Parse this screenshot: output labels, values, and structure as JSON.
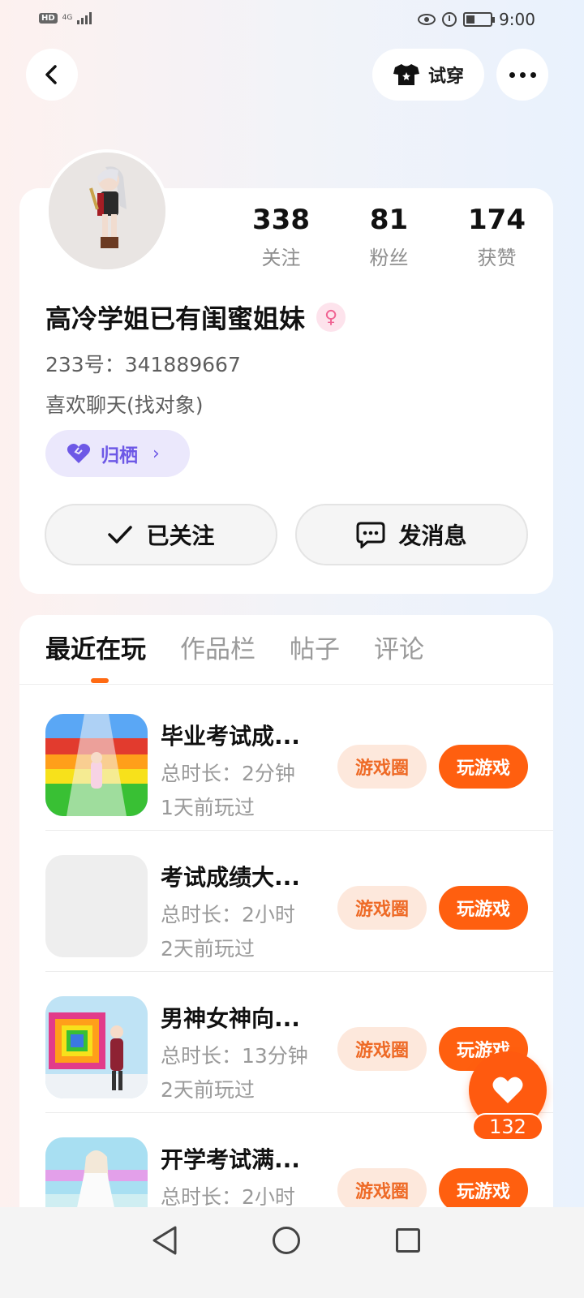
{
  "status_bar": {
    "hd": "HD",
    "network": "4G",
    "time": "9:00",
    "battery_level": 0.35
  },
  "header": {
    "try_on_label": "试穿"
  },
  "profile": {
    "stats": [
      {
        "value": "338",
        "label": "关注"
      },
      {
        "value": "81",
        "label": "粉丝"
      },
      {
        "value": "174",
        "label": "获赞"
      }
    ],
    "username": "高冷学姐已有闺蜜姐妹",
    "id_line": "233号：341889667",
    "bio": "喜欢聊天(找对象)",
    "home_label": "归栖",
    "followed_label": "已关注",
    "message_label": "发消息"
  },
  "tabs": [
    {
      "label": "最近在玩",
      "active": true
    },
    {
      "label": "作品栏",
      "active": false
    },
    {
      "label": "帖子",
      "active": false
    },
    {
      "label": "评论",
      "active": false
    }
  ],
  "games": [
    {
      "title": "毕业考试成...",
      "duration": "总时长：2分钟",
      "last_played": "1天前玩过",
      "circle_label": "游戏圈",
      "play_label": "玩游戏"
    },
    {
      "title": "考试成绩大...",
      "duration": "总时长：2小时",
      "last_played": "2天前玩过",
      "circle_label": "游戏圈",
      "play_label": "玩游戏"
    },
    {
      "title": "男神女神向...",
      "duration": "总时长：13分钟",
      "last_played": "2天前玩过",
      "circle_label": "游戏圈",
      "play_label": "玩游戏"
    },
    {
      "title": "开学考试满...",
      "duration": "总时长：2小时",
      "last_played": "",
      "circle_label": "游戏圈",
      "play_label": "玩游戏"
    }
  ],
  "like_fab": {
    "count": "132"
  },
  "colors": {
    "accent": "#ff5f0f",
    "home_pill": "#6d58e6",
    "gender": "#f06292"
  }
}
